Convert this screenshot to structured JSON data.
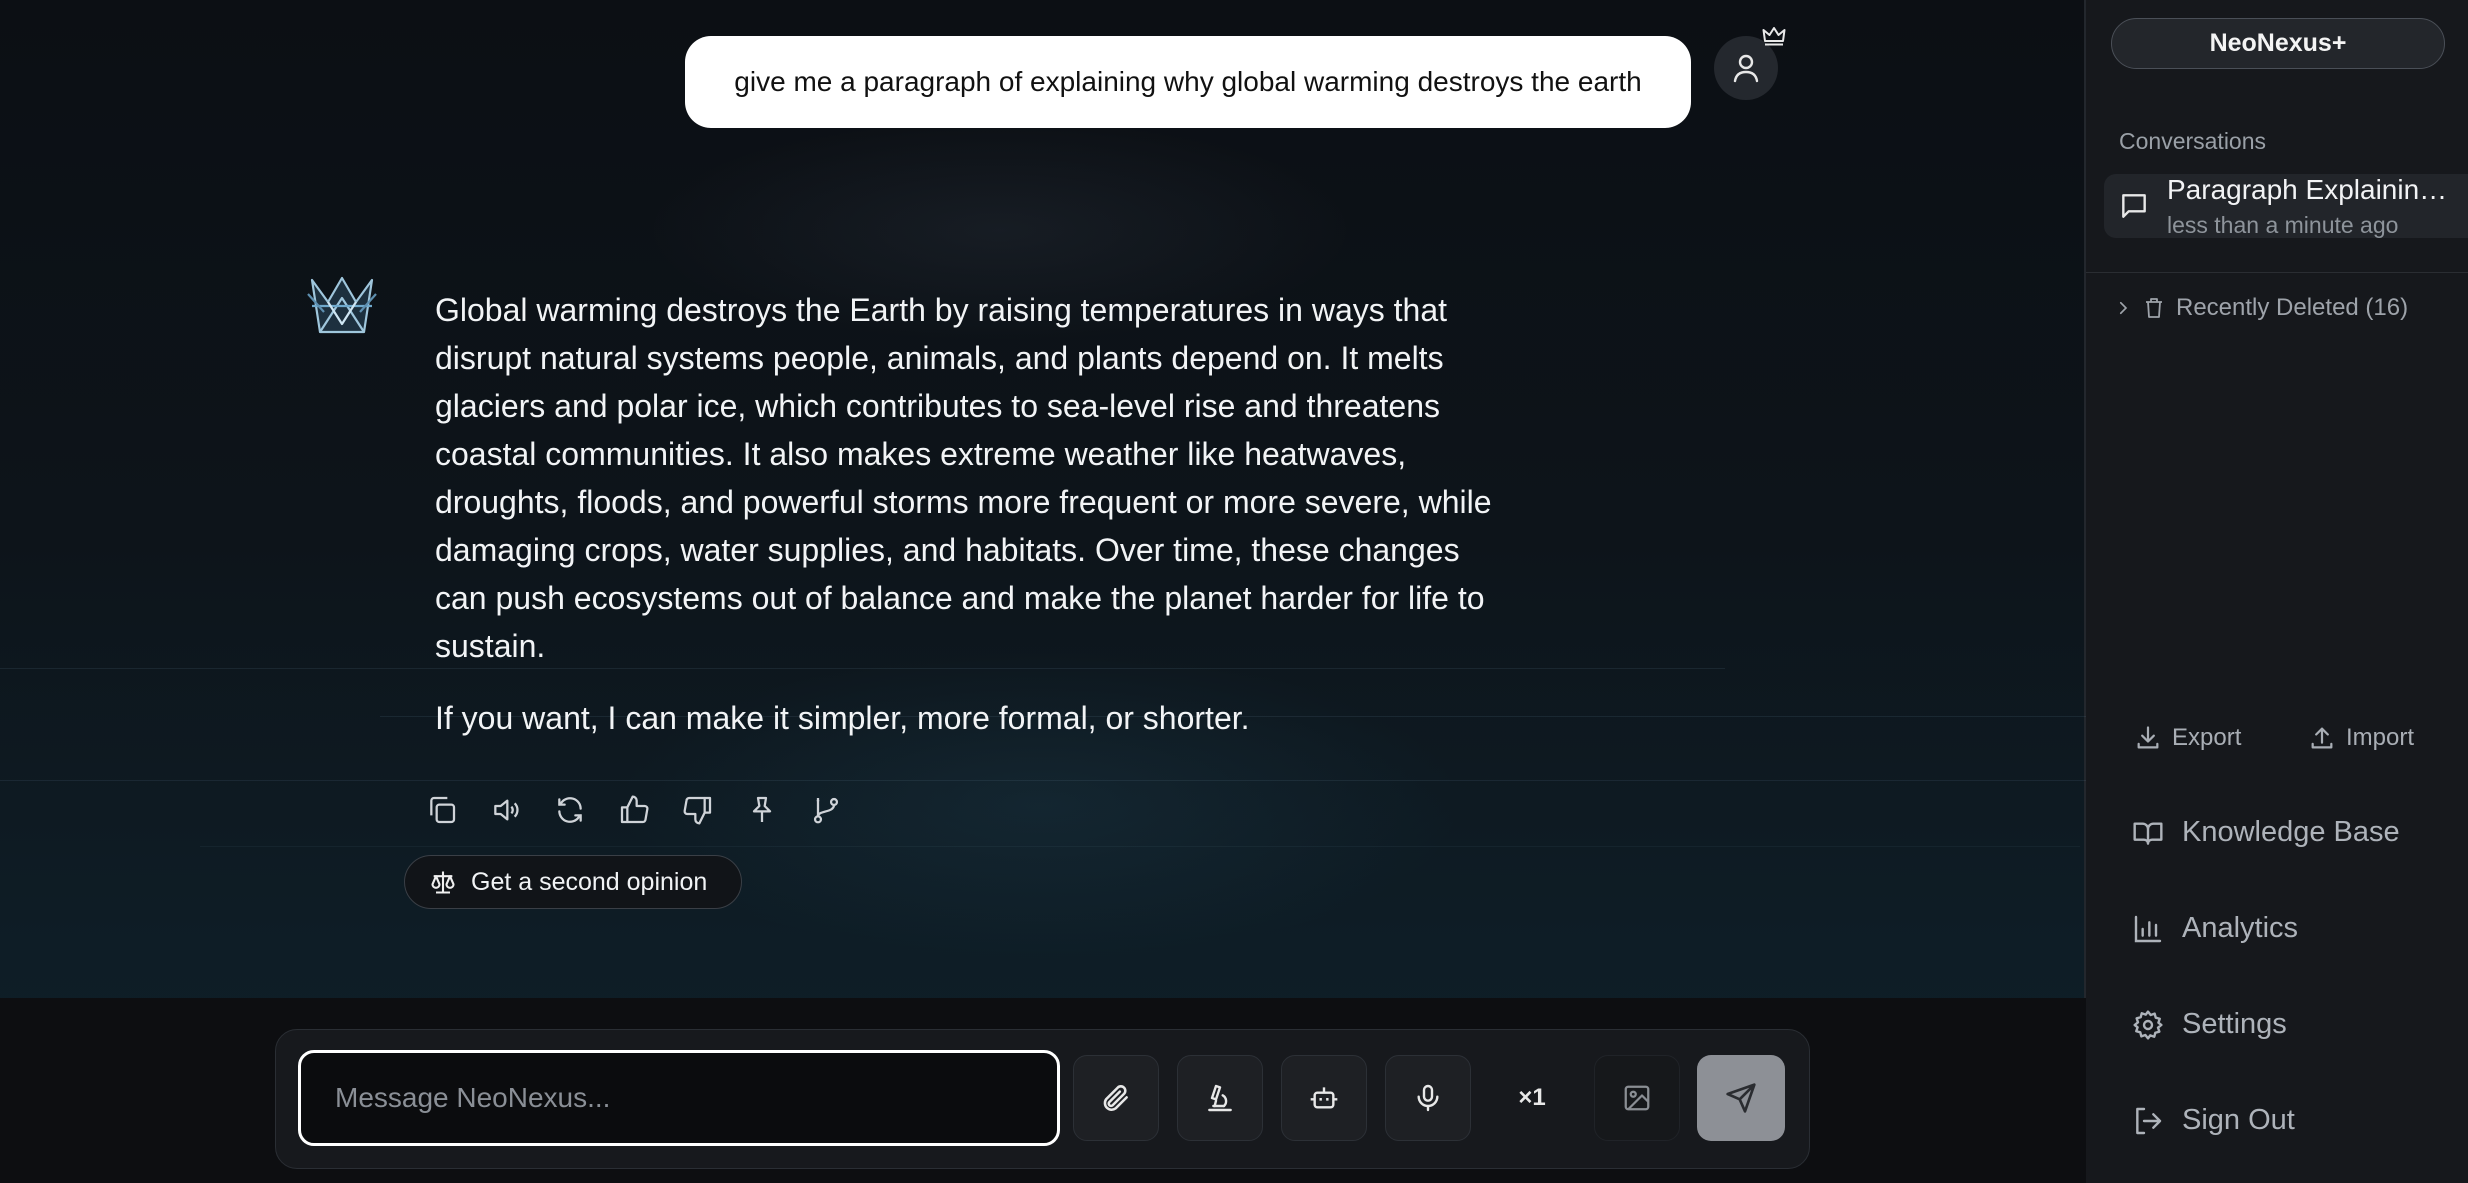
{
  "chat": {
    "user_message": "give me a paragraph of explaining why global warming destroys the earth",
    "assistant_paragraphs": [
      "Global warming destroys the Earth by raising temperatures in ways that disrupt natural systems people, animals, and plants depend on. It melts glaciers and polar ice, which contributes to sea-level rise and threatens coastal communities. It also makes extreme weather like heatwaves, droughts, floods, and powerful storms more frequent or more severe, while damaging crops, water supplies, and habitats. Over time, these changes can push ecosystems out of balance and make the planet harder for life to sustain.",
      "If you want, I can make it simpler, more formal, or shorter."
    ],
    "action_icons": [
      "copy-icon",
      "speaker-icon",
      "regenerate-icon",
      "thumbs-up-icon",
      "thumbs-down-icon",
      "pin-icon",
      "branch-icon"
    ],
    "second_opinion_label": "Get a second opinion"
  },
  "composer": {
    "placeholder": "Message NeoNexus...",
    "multiplier": "×1",
    "buttons": [
      "paperclip-icon",
      "microscope-icon",
      "bot-icon",
      "microphone-icon",
      "image-icon",
      "send-icon"
    ]
  },
  "sidebar": {
    "brand": "NeoNexus+",
    "conversations_heading": "Conversations",
    "conversations": [
      {
        "title": "Paragraph Explaining Global Warming",
        "time": "less than a minute ago"
      }
    ],
    "recently_deleted": "Recently Deleted (16)",
    "export_label": "Export",
    "import_label": "Import",
    "links": {
      "knowledge_base": "Knowledge Base",
      "analytics": "Analytics",
      "settings": "Settings",
      "sign_out": "Sign Out"
    }
  }
}
